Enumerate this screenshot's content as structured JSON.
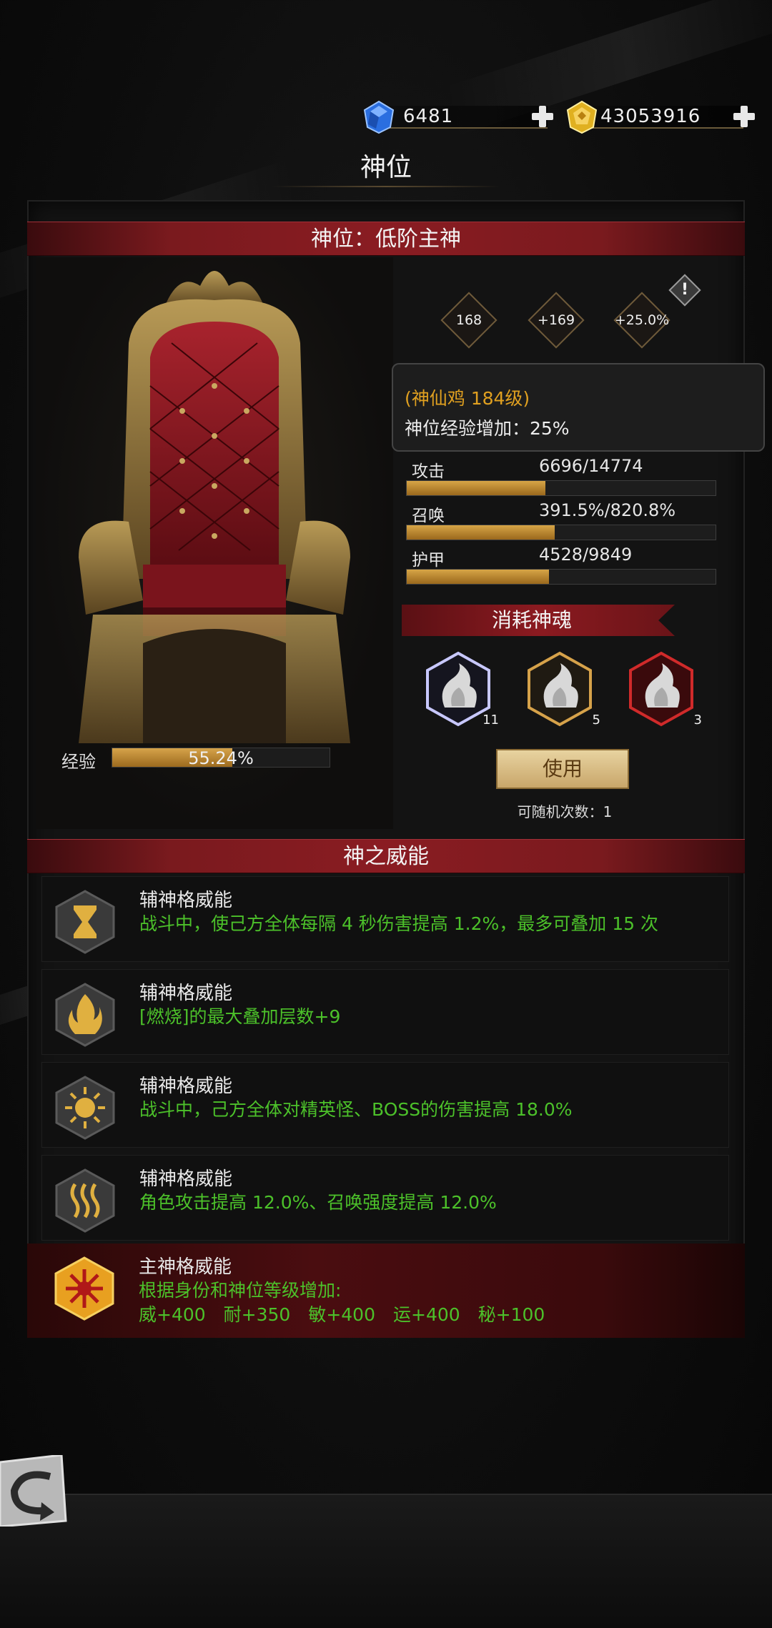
{
  "currency": {
    "gems": "6481",
    "gold": "43053916"
  },
  "page": {
    "title": "神位"
  },
  "rank_banner": "神位：低阶主神",
  "badges": [
    "168",
    "+169",
    "+25.0%"
  ],
  "alert_symbol": "!",
  "tooltip": {
    "line1": "(神仙鸡 184级)",
    "line2": "神位经验增加：25%"
  },
  "stats": [
    {
      "name": "攻击",
      "value": "6696/14774",
      "fill": 0.45
    },
    {
      "name": "召唤",
      "value": "391.5%/820.8%",
      "fill": 0.48
    },
    {
      "name": "护甲",
      "value": "4528/9849",
      "fill": 0.46
    }
  ],
  "experience": {
    "label": "经验",
    "value": "55.24%",
    "fill": 0.5524
  },
  "consume_title": "消耗神魂",
  "souls": [
    {
      "count": "11",
      "color": "#c8c8ff"
    },
    {
      "count": "5",
      "color": "#d6a24a"
    },
    {
      "count": "3",
      "color": "#d02a2a"
    }
  ],
  "use_button": "使用",
  "random_count": "可随机次数：1",
  "power_banner": "神之威能",
  "abilities": [
    {
      "title": "辅神格威能",
      "desc": "战斗中，使己方全体每隔 4 秒伤害提高 1.2%，最多可叠加 15 次",
      "icon": "hourglass-icon"
    },
    {
      "title": "辅神格威能",
      "desc": "[燃烧]的最大叠加层数+9",
      "icon": "flame-icon"
    },
    {
      "title": "辅神格威能",
      "desc": "战斗中，己方全体对精英怪、BOSS的伤害提高 18.0%",
      "icon": "sun-icon"
    },
    {
      "title": "辅神格威能",
      "desc": "角色攻击提高 12.0%、召唤强度提高 12.0%",
      "icon": "wave-icon"
    }
  ],
  "main_ability": {
    "title": "主神格威能",
    "desc1": "根据身份和神位等级增加:",
    "desc2": "威+400　耐+350　敏+400　运+400　秘+100",
    "icon": "star-burst-icon"
  },
  "colors": {
    "accent_gold": "#d6a34a",
    "banner_red": "#8a1c22",
    "text_green": "#4cc12a",
    "tooltip_orange": "#e0a020"
  }
}
